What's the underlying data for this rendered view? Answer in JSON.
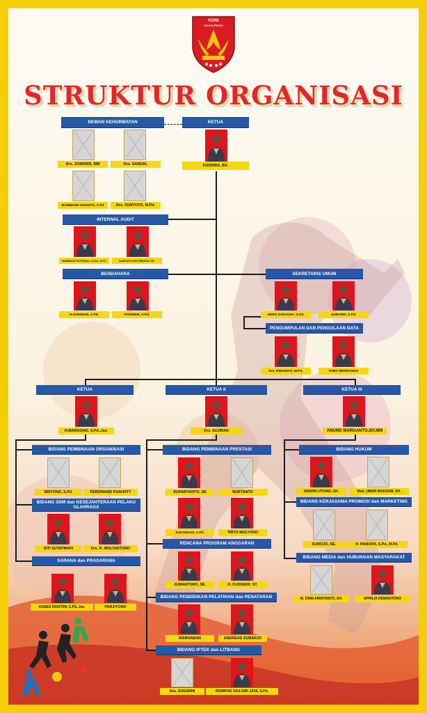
{
  "logo": {
    "org": "KONI",
    "region": "KULON PROGO"
  },
  "title": "STRUKTUR ORGANISASI",
  "headers": {
    "dewan": "DEWAN KEHORMATAN",
    "ketua_umum": "KETUA",
    "audit": "INTERNAL AUDIT",
    "bendahara": "BENDAHARA",
    "sekretaris": "SEKRETARIS UMUM",
    "pengumpulan": "PENGUMPULAN DAN PENGOLAAN DATA",
    "ketua1": "KETUA",
    "ketua2": "KETUA II",
    "ketua3": "KETUA III",
    "b_organisasi": "BIDANG PEMBINAAN ORGANISASI",
    "b_sdm": "BIDANG SDM dan KESEJAHTERAAN PELAKU OLAHRAGA",
    "b_sarana": "SARANA dan PRASARANA",
    "b_prestasi": "BIDANG PEMBINAAN PRESTASI",
    "b_anggaran": "RENCANA PROGRAM ANGGARAN",
    "b_diklat": "BIDANG PENDIDIKAN PELATIHAN dan PENATARAN",
    "b_iptek": "BIDANG IPTEK dan LITBANG",
    "b_hukum": "BIDANG HUKUM",
    "b_promosi": "BIDANG KERJASAMA PROMOSI dan MARKETING",
    "b_media": "BIDANG MEDIA dan HUBUNGAN MASYARAKAT"
  },
  "names": {
    "juwardi": "Drs. JUWARDI, MM",
    "sardal": "Drs. SARDAL",
    "kusdira": "KUSDIRA, BA.",
    "bambang_gunoto": "BAMBANG GUNOTO, S.Pd",
    "sunyoto": "Drs. SUNYOTO, M.Pd.",
    "bambang_sutrisno": "BAMBANG SUTRISNO, S.Sos., M.Si.",
    "barkah": "BARKAH HARI WIBOWO, SE.",
    "sukiman": "H.SUKIMAN, S.Pd.",
    "parinem": "PARINEM, S.Pd.",
    "heru": "HERU SARJANA, S.Pd.",
    "subardi": "SUBARDI, S.Pd.",
    "rinawati": "Dra. RINAWATI, M.Pd.",
    "pabo": "PABO BERNANDO",
    "margono": "H.MARGONO, S.Pd.,Jas.",
    "sujiran": "Drs. SUJIRAN",
    "anung": "ANUNG MARGANTO,SH.MM",
    "sriyono": "SRIYONO, S.Pd.",
    "ferdinand": "FERDINAND KUAHATY",
    "siti": "SITI SUYATIMAH",
    "molyartono": "Drs. R. MOLYARTONO",
    "agnes": "AGNES KRISTINI, S.Pd.,Jas.",
    "parjiyono": "PARJIYONO",
    "suharyanto": "SUHARYANTO, SE",
    "nurtanto": "NURTANTO",
    "sukismadi": "SUKISMADI, S.Pd.",
    "tirto": "TIRTO MULYONO",
    "jumantoro": "JUMANTORO, SE.",
    "kuswadi": "H. KUSWADI. ST.",
    "marhaban": "MARHABAN",
    "andreas": "ANDREAS SUBARJO",
    "sukarni": "Dra. SUKARNI",
    "romphis": "ROMPHIS OKA DWI JAYA, S.Pd.",
    "hendri": "HENDRI UTOMO, SH.",
    "umar": "Muh. UMAR MAKSUM, SH.",
    "surojo": "SUROJO, SE.",
    "pandaya": "H. PANDAYA, S.Pd., M.Pd.",
    "dani": "M. DANI ARDIYANTO, SH.",
    "aprilia": "APRILIA DEWANTORO"
  },
  "colors": {
    "header_blue": "#2558a8",
    "name_yellow": "#f6d70c",
    "photo_red": "#e0141b",
    "title_red": "#e3262a",
    "frame_yellow": "#f4cf08"
  }
}
